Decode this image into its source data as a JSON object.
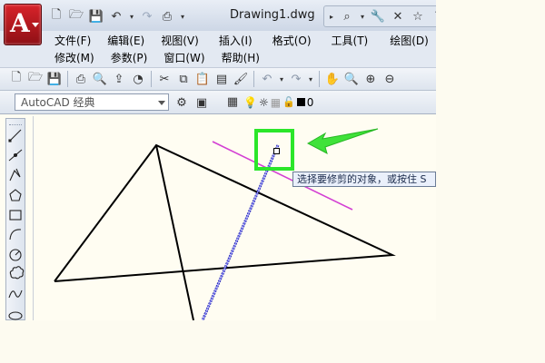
{
  "app": {
    "logo_letter": "A",
    "doc_title": "Drawing1.dwg"
  },
  "quick_access": [
    "new-file-icon",
    "open-folder-icon",
    "save-icon",
    "undo-icon",
    "redo-icon",
    "print-icon"
  ],
  "title_tools": [
    "binoculars-icon",
    "wrench-icon",
    "tools-icon",
    "star-icon",
    "help-icon"
  ],
  "menus": {
    "row1": [
      {
        "id": "file",
        "label": "文件(F)"
      },
      {
        "id": "edit",
        "label": "编辑(E)"
      },
      {
        "id": "view",
        "label": "视图(V)"
      },
      {
        "id": "insert",
        "label": "插入(I)"
      },
      {
        "id": "format",
        "label": "格式(O)"
      },
      {
        "id": "tools",
        "label": "工具(T)"
      },
      {
        "id": "draw",
        "label": "绘图(D)"
      }
    ],
    "row2": [
      {
        "id": "modify",
        "label": "修改(M)"
      },
      {
        "id": "param",
        "label": "参数(P)"
      },
      {
        "id": "window",
        "label": "窗口(W)"
      },
      {
        "id": "help",
        "label": "帮助(H)"
      }
    ]
  },
  "workspace": {
    "value": "AutoCAD 经典"
  },
  "layer": {
    "name": "0",
    "color": "#000000"
  },
  "tooltip": {
    "text": "选择要修剪的对象，或按住 S"
  },
  "colors": {
    "highlight": "#2be62a",
    "trim_line": "#3a3ad0",
    "cut_edge": "#d33fd3",
    "canvas": "#fffdf2"
  }
}
